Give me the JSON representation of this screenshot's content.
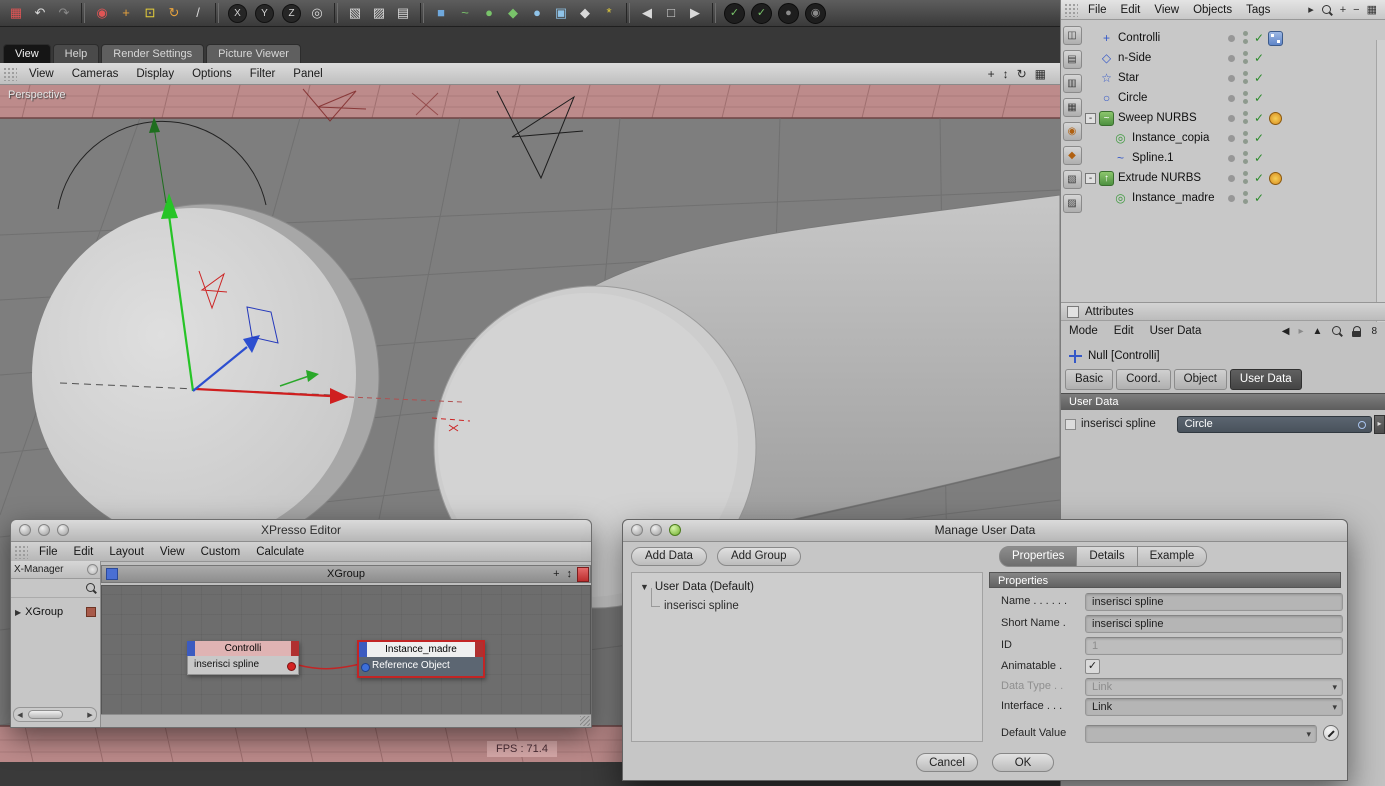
{
  "colors": {
    "viewport_ground": "#bd8b8b",
    "viewport_bg": "#7e7e7e",
    "selection_red": "#cc2222",
    "link_field_bg": "#4e5a66",
    "node_port_red": "#d42222",
    "node_port_blue": "#3d6fd8",
    "check_green": "#2e8b2e",
    "tag_orange": "#e0a030",
    "xpresso_tag_blue": "#6a8fd8"
  },
  "toolbar": {
    "icons": [
      {
        "name": "save-icon",
        "glyph": "▦"
      },
      {
        "name": "undo-icon",
        "glyph": "↶"
      },
      {
        "name": "redo-icon",
        "glyph": "↷"
      },
      {
        "name": "live-selection-icon",
        "glyph": "◉"
      },
      {
        "name": "move-icon",
        "glyph": "+"
      },
      {
        "name": "scale-icon",
        "glyph": "⊡"
      },
      {
        "name": "rotate-icon",
        "glyph": "↻"
      },
      {
        "name": "last-tool-icon",
        "glyph": "/"
      },
      {
        "name": "lock-x-icon",
        "glyph": "X"
      },
      {
        "name": "lock-y-icon",
        "glyph": "Y"
      },
      {
        "name": "lock-z-icon",
        "glyph": "Z"
      },
      {
        "name": "coord-system-icon",
        "glyph": "◎"
      },
      {
        "name": "render-view-icon",
        "glyph": "▧"
      },
      {
        "name": "render-region-icon",
        "glyph": "▨"
      },
      {
        "name": "render-settings-icon",
        "glyph": "▤"
      },
      {
        "name": "add-cube-icon",
        "glyph": "■"
      },
      {
        "name": "add-spline-icon",
        "glyph": "~"
      },
      {
        "name": "add-generator-icon",
        "glyph": "●"
      },
      {
        "name": "add-modeling-icon",
        "glyph": "◆"
      },
      {
        "name": "add-environment-icon",
        "glyph": "●"
      },
      {
        "name": "add-scene-icon",
        "glyph": "▣"
      },
      {
        "name": "add-camera-icon",
        "glyph": "◆"
      },
      {
        "name": "add-light-icon",
        "glyph": "*"
      },
      {
        "name": "nav-back-icon",
        "glyph": "◀"
      },
      {
        "name": "nav-doc-icon",
        "glyph": "□"
      },
      {
        "name": "nav-forward-icon",
        "glyph": "▶"
      },
      {
        "name": "toggle-a-icon",
        "glyph": "✓"
      },
      {
        "name": "toggle-b-icon",
        "glyph": "✓"
      },
      {
        "name": "toggle-c-icon",
        "glyph": "●"
      },
      {
        "name": "toggle-d-icon",
        "glyph": "◉"
      }
    ]
  },
  "right_menubar": {
    "items": [
      "File",
      "Edit",
      "View",
      "Objects",
      "Tags"
    ],
    "icons": [
      {
        "name": "jump-icon",
        "glyph": "▸"
      },
      {
        "name": "search-icon",
        "glyph": ""
      },
      {
        "name": "pan-icon",
        "glyph": "+"
      },
      {
        "name": "minimize-icon",
        "glyph": "−"
      },
      {
        "name": "layout-icon",
        "glyph": "▦"
      }
    ]
  },
  "workspace": {
    "tabs": [
      {
        "label": "View",
        "active": true
      },
      {
        "label": "Help",
        "active": false
      },
      {
        "label": "Render Settings",
        "active": false
      },
      {
        "label": "Picture Viewer",
        "active": false
      }
    ]
  },
  "viewport": {
    "menu": [
      "View",
      "Cameras",
      "Display",
      "Options",
      "Filter",
      "Panel"
    ],
    "icons": [
      {
        "name": "move-view-icon",
        "glyph": "+"
      },
      {
        "name": "zoom-view-icon",
        "glyph": "↕"
      },
      {
        "name": "rotate-view-icon",
        "glyph": "↻"
      },
      {
        "name": "toggle-panels-icon",
        "glyph": "▦"
      }
    ],
    "label": "Perspective",
    "fps": "FPS : 71.4"
  },
  "object_manager": {
    "check_glyph": "✓",
    "items": [
      {
        "label": "Controlli",
        "depth": 0,
        "expander": "",
        "icon_glyph": "+",
        "tag": "xpresso"
      },
      {
        "label": "n-Side",
        "depth": 0,
        "expander": "",
        "icon_glyph": "◇",
        "tag": ""
      },
      {
        "label": "Star",
        "depth": 0,
        "expander": "",
        "icon_glyph": "☆",
        "tag": ""
      },
      {
        "label": "Circle",
        "depth": 0,
        "expander": "",
        "icon_glyph": "○",
        "tag": ""
      },
      {
        "label": "Sweep NURBS",
        "depth": 0,
        "expander": "-",
        "icon_glyph": "~",
        "tag": "orange"
      },
      {
        "label": "Instance_copia",
        "depth": 1,
        "expander": "",
        "icon_glyph": "◎",
        "tag": ""
      },
      {
        "label": "Spline.1",
        "depth": 1,
        "expander": "",
        "icon_glyph": "~",
        "tag": ""
      },
      {
        "label": "Extrude NURBS",
        "depth": 0,
        "expander": "-",
        "icon_glyph": "↑",
        "tag": "orange"
      },
      {
        "label": "Instance_madre",
        "depth": 1,
        "expander": "",
        "icon_glyph": "◎",
        "tag": ""
      }
    ]
  },
  "attributes": {
    "panel_title": "Attributes",
    "menu": [
      "Mode",
      "Edit",
      "User Data"
    ],
    "icons": {
      "back": "◀",
      "forward": "▸",
      "up": "▲",
      "link": "8"
    },
    "object_label": "Null [Controlli]",
    "tabs": [
      {
        "label": "Basic",
        "active": false
      },
      {
        "label": "Coord.",
        "active": false
      },
      {
        "label": "Object",
        "active": false
      },
      {
        "label": "User Data",
        "active": true
      }
    ],
    "section_title": "User Data",
    "field_label": "inserisci spline",
    "field_value": "Circle",
    "field_button_glyph": "▸"
  },
  "xpresso": {
    "title": "XPresso Editor",
    "menu": [
      "File",
      "Edit",
      "Layout",
      "View",
      "Custom",
      "Calculate"
    ],
    "manager_label": "X-Manager",
    "tree_arrow": "▶",
    "tree_item": "XGroup",
    "group_title": "XGroup",
    "header_icons": {
      "move": "+",
      "scale": "↕"
    },
    "scroll_left": "◀",
    "scroll_right": "▶",
    "node1": {
      "title": "Controlli",
      "row": "inserisci spline"
    },
    "node2": {
      "title": "Instance_madre",
      "row": "Reference Object"
    }
  },
  "manage": {
    "title": "Manage User Data",
    "add_data_label": "Add Data",
    "add_group_label": "Add Group",
    "tabs": [
      {
        "label": "Properties",
        "active": true
      },
      {
        "label": "Details",
        "active": false
      },
      {
        "label": "Example",
        "active": false
      }
    ],
    "tree_collapse_glyph": "▼",
    "tree_root": "User Data (Default)",
    "tree_child": "inserisci spline",
    "section_title": "Properties",
    "rows": {
      "name_label": "Name . . . . . .",
      "name_value": "inserisci spline",
      "short_label": "Short Name .",
      "short_value": "inserisci spline",
      "id_label": "ID",
      "id_value": "1",
      "anim_label": "Animatable .",
      "check_glyph": "✓",
      "datatype_label": "Data Type . .",
      "datatype_value": "Link",
      "interface_label": "Interface . . .",
      "interface_value": "Link",
      "dd_glyph": "▾",
      "default_label": "Default Value"
    },
    "cancel_label": "Cancel",
    "ok_label": "OK"
  }
}
